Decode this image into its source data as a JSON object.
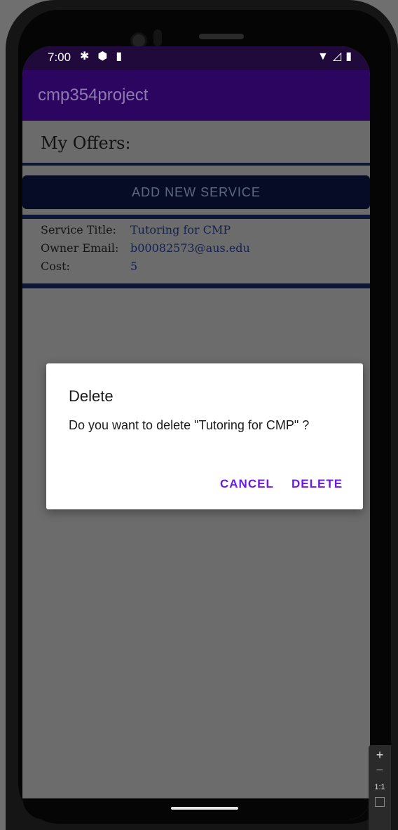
{
  "statusbar": {
    "time": "7:00",
    "icons_left": [
      "gear-icon",
      "shield-icon",
      "sd-card-icon"
    ],
    "icons_right": [
      "wifi-icon",
      "signal-icon",
      "battery-icon"
    ]
  },
  "appbar": {
    "title": "cmp354project"
  },
  "header": {
    "title": "My Offers:"
  },
  "actions": {
    "add_service_label": "ADD NEW SERVICE"
  },
  "offer": {
    "title_label": "Service Title:",
    "title_value": "Tutoring for CMP",
    "email_label": "Owner Email:",
    "email_value": "b00082573@aus.edu",
    "cost_label": "Cost:",
    "cost_value": "5"
  },
  "dialog": {
    "title": "Delete",
    "message": "Do you want to delete \"Tutoring for CMP\"  ?",
    "cancel_label": "CANCEL",
    "delete_label": "DELETE"
  },
  "emulator_zoom": {
    "plus": "+",
    "minus": "−",
    "reset": "1:1"
  },
  "colors": {
    "appbar": "#2c0560",
    "accent": "#6d1ae6",
    "button": "#060c26"
  }
}
